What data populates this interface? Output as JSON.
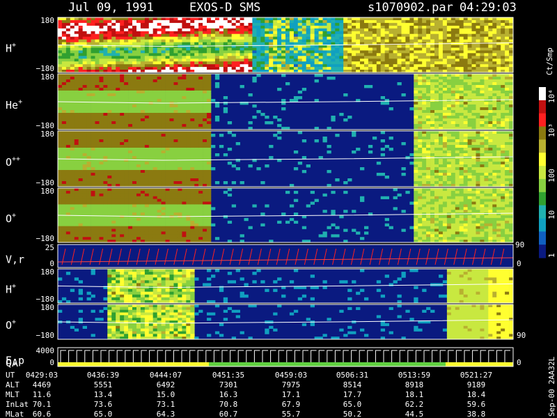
{
  "header": {
    "date": "Jul 09, 1991",
    "instrument": "EXOS-D SMS",
    "file": "s1070902.par",
    "time": "04:29:03"
  },
  "colorbar": {
    "unit": "Ct/Smp",
    "ticks": [
      "10⁴",
      "10³",
      "100",
      "10",
      "1"
    ],
    "colors": [
      "#ffffff",
      "#c01010",
      "#ff2020",
      "#8b7a10",
      "#b8b030",
      "#ffff30",
      "#c8e840",
      "#88d040",
      "#30a030",
      "#20b0b0",
      "#10a0c0",
      "#1060c0",
      "#0a1a80"
    ]
  },
  "panels": [
    {
      "label": "H",
      "sup": "+",
      "ytop": "180",
      "ybot": "−180",
      "density": "high"
    },
    {
      "label": "He",
      "sup": "+",
      "ytop": "180",
      "ybot": "−180",
      "density": "mid"
    },
    {
      "label": "O",
      "sup": "++",
      "ytop": "180",
      "ybot": "−180",
      "density": "mid"
    },
    {
      "label": "O",
      "sup": "+",
      "ytop": "180",
      "ybot": "−180",
      "density": "mid"
    },
    {
      "label": "V,r",
      "sup": "",
      "ytop": "25",
      "ybot": "0",
      "right_top": "90",
      "right_bot": "0",
      "density": "line"
    },
    {
      "label": "H",
      "sup": "+",
      "ytop": "180",
      "ybot": "−180",
      "density": "low"
    },
    {
      "label": "O",
      "sup": "+",
      "ytop": "180",
      "ybot": "−180",
      "right_bot": "90",
      "density": "low"
    },
    {
      "label": "E,p",
      "sup": "",
      "label2": "QA",
      "ytop": "4000",
      "ybot": "0",
      "right_bot": "0",
      "density": "qa"
    }
  ],
  "footer": {
    "side_label": "Sep-00 2AA32L",
    "rows": [
      {
        "name": "UT",
        "values": [
          "0429:03",
          "0436:39",
          "0444:07",
          "0451:35",
          "0459:03",
          "0506:31",
          "0513:59",
          "0521:27"
        ]
      },
      {
        "name": "ALT",
        "values": [
          "4469",
          "5551",
          "6492",
          "7301",
          "7975",
          "8514",
          "8918",
          "9189"
        ]
      },
      {
        "name": "MLT",
        "values": [
          "11.6",
          "13.4",
          "15.0",
          "16.3",
          "17.1",
          "17.7",
          "18.1",
          "18.4"
        ]
      },
      {
        "name": "InLat",
        "values": [
          "70.1",
          "73.6",
          "73.1",
          "70.8",
          "67.9",
          "65.0",
          "62.2",
          "59.6"
        ]
      },
      {
        "name": "MLat",
        "values": [
          "60.6",
          "65.0",
          "64.3",
          "60.7",
          "55.7",
          "50.2",
          "44.5",
          "38.8"
        ]
      }
    ]
  },
  "chart_data": {
    "type": "heatmap",
    "title": "Jul 09, 1991 EXOS-D SMS",
    "x": [
      "0429:03",
      "0436:39",
      "0444:07",
      "0451:35",
      "0459:03",
      "0506:31",
      "0513:59",
      "0521:27"
    ],
    "series": [
      {
        "name": "H+",
        "ylim": [
          -180,
          180
        ]
      },
      {
        "name": "He+",
        "ylim": [
          -180,
          180
        ]
      },
      {
        "name": "O++",
        "ylim": [
          -180,
          180
        ]
      },
      {
        "name": "O+",
        "ylim": [
          -180,
          180
        ]
      },
      {
        "name": "V,r",
        "ylim": [
          0,
          25
        ]
      },
      {
        "name": "H+",
        "ylim": [
          -180,
          180
        ]
      },
      {
        "name": "O+",
        "ylim": [
          -180,
          180
        ]
      },
      {
        "name": "E,p",
        "ylim": [
          0,
          4000
        ]
      }
    ],
    "colorbar_label": "Ct/Smp",
    "colorbar_ticks": [
      "10⁴",
      "10³",
      "100",
      "10",
      "1"
    ]
  }
}
